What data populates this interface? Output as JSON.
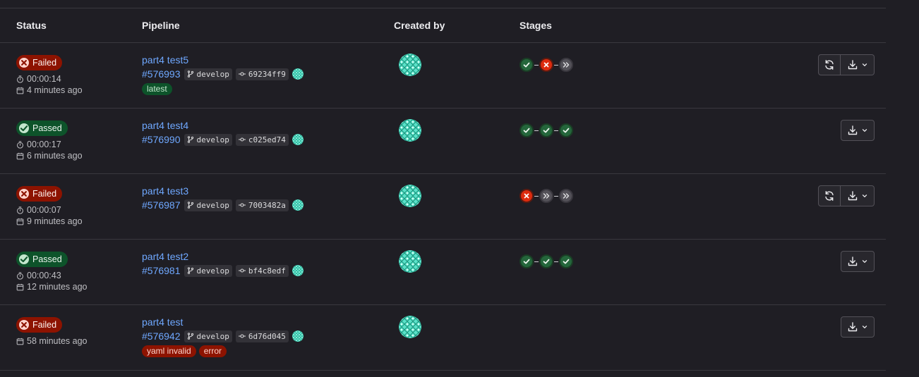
{
  "headers": {
    "status": "Status",
    "pipeline": "Pipeline",
    "created_by": "Created by",
    "stages": "Stages"
  },
  "colors": {
    "failed": "#8d1300",
    "passed": "#0d532a",
    "link": "#6fa8ff",
    "stage_success": "#24663b",
    "stage_failed": "#dd2b0e",
    "stage_skipped": "#535158"
  },
  "rows": [
    {
      "status": "Failed",
      "duration": "00:00:14",
      "finished": "4 minutes ago",
      "title": "part4 test5",
      "id": "#576993",
      "branch": "develop",
      "commit": "69234ff9",
      "labels": [
        "latest"
      ],
      "stages": [
        "success",
        "failed",
        "skipped"
      ],
      "retry": true
    },
    {
      "status": "Passed",
      "duration": "00:00:17",
      "finished": "6 minutes ago",
      "title": "part4 test4",
      "id": "#576990",
      "branch": "develop",
      "commit": "c025ed74",
      "labels": [],
      "stages": [
        "success",
        "success",
        "success"
      ],
      "retry": false
    },
    {
      "status": "Failed",
      "duration": "00:00:07",
      "finished": "9 minutes ago",
      "title": "part4 test3",
      "id": "#576987",
      "branch": "develop",
      "commit": "7003482a",
      "labels": [],
      "stages": [
        "failed",
        "skipped",
        "skipped"
      ],
      "retry": true
    },
    {
      "status": "Passed",
      "duration": "00:00:43",
      "finished": "12 minutes ago",
      "title": "part4 test2",
      "id": "#576981",
      "branch": "develop",
      "commit": "bf4c8edf",
      "labels": [],
      "stages": [
        "success",
        "success",
        "success"
      ],
      "retry": false
    },
    {
      "status": "Failed",
      "duration": "",
      "finished": "58 minutes ago",
      "title": "part4 test",
      "id": "#576942",
      "branch": "develop",
      "commit": "6d76d045",
      "labels": [
        "yaml invalid",
        "error"
      ],
      "stages": [],
      "retry": false
    }
  ]
}
